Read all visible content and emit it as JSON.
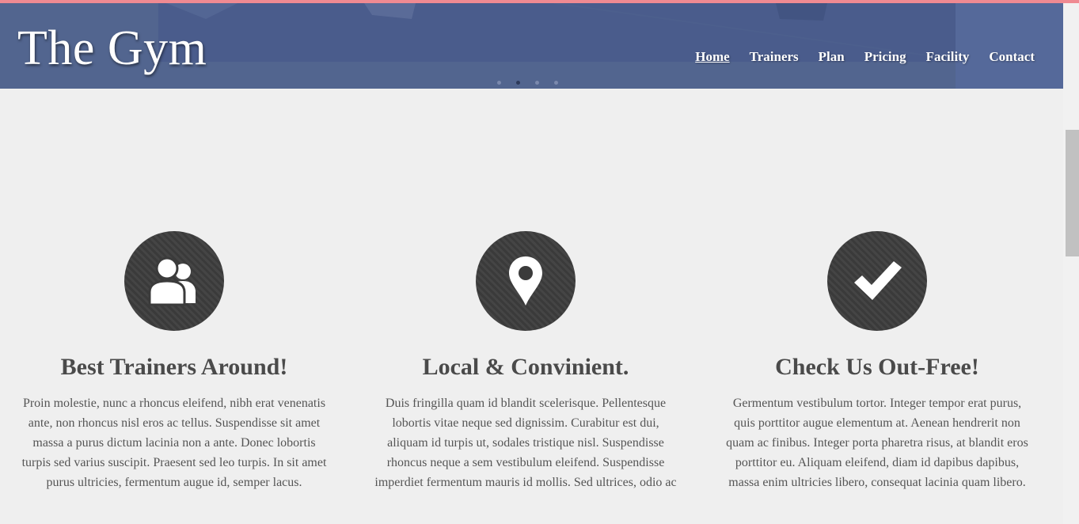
{
  "brand": {
    "logo_text": "The Gym"
  },
  "nav": {
    "items": [
      {
        "label": "Home",
        "active": true
      },
      {
        "label": "Trainers",
        "active": false
      },
      {
        "label": "Plan",
        "active": false
      },
      {
        "label": "Pricing",
        "active": false
      },
      {
        "label": "Facility",
        "active": false
      },
      {
        "label": "Contact",
        "active": false
      }
    ]
  },
  "slider": {
    "dot_count": 4,
    "active_index": 1
  },
  "features": [
    {
      "icon": "users-icon",
      "title": "Best Trainers Around!",
      "text": "Proin molestie, nunc a rhoncus eleifend, nibh erat venenatis ante, non rhoncus nisl eros ac tellus. Suspendisse sit amet massa a purus dictum lacinia non a ante. Donec lobortis turpis sed varius suscipit. Praesent sed leo turpis. In sit amet purus ultricies, fermentum augue id, semper lacus."
    },
    {
      "icon": "map-pin-icon",
      "title": "Local & Convinient.",
      "text": "Duis fringilla quam id blandit scelerisque. Pellentesque lobortis vitae neque sed dignissim. Curabitur est dui, aliquam id turpis ut, sodales tristique nisl. Suspendisse rhoncus neque a sem vestibulum eleifend. Suspendisse imperdiet fermentum mauris id mollis. Sed ultrices, odio ac"
    },
    {
      "icon": "checkmark-icon",
      "title": "Check Us Out-Free!",
      "text": "Germentum vestibulum tortor. Integer tempor erat purus, quis porttitor augue elementum at. Aenean hendrerit non quam ac finibus. Integer porta pharetra risus, at blandit eros porttitor eu. Aliquam eleifend, diam id dapibus dapibus, massa enim ultricies libero, consequat lacinia quam libero."
    }
  ],
  "colors": {
    "header_bg": "#4f6290",
    "top_strip": "#ef8a92",
    "page_bg": "#efefef",
    "icon_circle": "#3b3b3b"
  }
}
